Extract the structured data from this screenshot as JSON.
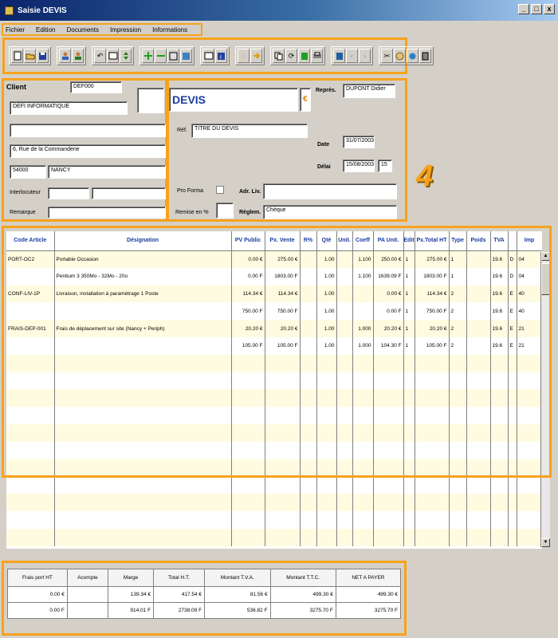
{
  "window": {
    "title": "Saisie DEVIS",
    "controls": [
      "_",
      "□",
      "x"
    ]
  },
  "menu": [
    "Fichier",
    "Edition",
    "Documents",
    "Impression",
    "Informations"
  ],
  "toolbar": {
    "groups": [
      [
        "new-doc-icon",
        "open-folder-icon",
        "save-icon"
      ],
      [
        "user-import-icon",
        "user-export-icon"
      ],
      [
        "undo-icon",
        "edit-icon",
        "sort-icon"
      ],
      [
        "add-line-icon",
        "remove-line-icon",
        "insert-icon",
        "list-icon"
      ],
      [
        "preview-icon",
        "info-icon"
      ],
      [
        "disabled-icon",
        "arrow-icon"
      ],
      [
        "copy-icon",
        "convert-icon",
        "calc-icon",
        "print-icon"
      ],
      [
        "book-icon",
        "nav-prev-icon",
        "nav-next-icon"
      ],
      [
        "cut-icon",
        "palette-icon",
        "settings-icon",
        "exit-icon"
      ]
    ]
  },
  "client": {
    "label": "Client",
    "code": "DEF000",
    "name": "DEFI INFORMATIQUE",
    "address1": "",
    "address2": "6, Rue de la Commanderie",
    "postcode": "54000",
    "city": "NANCY",
    "interlocutor_label": "Interlocuteur",
    "interlocutor_value": "",
    "remark_label": "Remarque",
    "remark_value": ""
  },
  "document": {
    "type": "DEVIS",
    "currency_symbol": "€",
    "reference_label": "Réf.",
    "reference": "TITRE DU DEVIS",
    "rep_label": "Représ.",
    "rep": "DUPONT Didier",
    "date_label": "Date",
    "date": "31/07/2003",
    "delay_label": "Délai",
    "delay_date": "15/08/2003",
    "delay_days": "15",
    "proforma_label": "Pro Forma",
    "delivery_label": "Adr. Liv.",
    "delivery_value": "",
    "discount_label": "Remise en %",
    "discount_value": "",
    "payment_label": "Réglem.",
    "payment_value": "Chèque"
  },
  "annotation_number": "4",
  "grid": {
    "columns": [
      "Code Article",
      "Désignation",
      "PV Public",
      "Px. Vente",
      "R%",
      "Qté",
      "Unit.",
      "Coeff",
      "PA Unit.",
      "Edit",
      "Px.Total HT",
      "Type",
      "Poids",
      "TVA",
      "",
      "Imp"
    ],
    "rows": [
      [
        "PORT-OC2",
        "Portable Occasion",
        "0.00 €",
        "275.00 €",
        "",
        "1.00",
        "",
        "1.100",
        "250.00 €",
        "1",
        "275.00 €",
        "1",
        "",
        "19.6",
        "D",
        "04"
      ],
      [
        "",
        "Pentium 3 350Mo - 32Mo - 20o",
        "0.00 F",
        "1803.00 F",
        "",
        "1.00",
        "",
        "1.100",
        "1639.09 F",
        "1",
        "1803.00 F",
        "1",
        "",
        "19.6",
        "D",
        "04"
      ],
      [
        "CONF-LIV-1P",
        "Livraison, installation à paramétrage 1 Poste",
        "114.34 €",
        "114.34 €",
        "",
        "1.00",
        "",
        "",
        "0.00 €",
        "1",
        "114.34 €",
        "2",
        "",
        "19.6",
        "E",
        "40"
      ],
      [
        "",
        "",
        "750.00 F",
        "750.00 F",
        "",
        "1.00",
        "",
        "",
        "0.00 F",
        "1",
        "750.00 F",
        "2",
        "",
        "19.6",
        "E",
        "40"
      ],
      [
        "FRAIS-DEP-001",
        "Frais de déplacement sur site (Nancy + Periph)",
        "20.20 €",
        "20.20 €",
        "",
        "1.00",
        "",
        "1.000",
        "20.20 €",
        "1",
        "20.20 €",
        "2",
        "",
        "19.6",
        "E",
        "21"
      ],
      [
        "",
        "",
        "105.00 F",
        "105.00 F",
        "",
        "1.00",
        "",
        "1.000",
        "104.30 F",
        "1",
        "105.00 F",
        "2",
        "",
        "19.6",
        "E",
        "21"
      ],
      [
        "",
        "",
        "",
        "",
        "",
        "",
        "",
        "",
        "",
        "",
        "",
        "",
        "",
        "",
        "",
        ""
      ],
      [
        "",
        "",
        "",
        "",
        "",
        "",
        "",
        "",
        "",
        "",
        "",
        "",
        "",
        "",
        "",
        ""
      ],
      [
        "",
        "",
        "",
        "",
        "",
        "",
        "",
        "",
        "",
        "",
        "",
        "",
        "",
        "",
        "",
        ""
      ],
      [
        "",
        "",
        "",
        "",
        "",
        "",
        "",
        "",
        "",
        "",
        "",
        "",
        "",
        "",
        "",
        ""
      ],
      [
        "",
        "",
        "",
        "",
        "",
        "",
        "",
        "",
        "",
        "",
        "",
        "",
        "",
        "",
        "",
        ""
      ],
      [
        "",
        "",
        "",
        "",
        "",
        "",
        "",
        "",
        "",
        "",
        "",
        "",
        "",
        "",
        "",
        ""
      ],
      [
        "",
        "",
        "",
        "",
        "",
        "",
        "",
        "",
        "",
        "",
        "",
        "",
        "",
        "",
        "",
        ""
      ],
      [
        "",
        "",
        "",
        "",
        "",
        "",
        "",
        "",
        "",
        "",
        "",
        "",
        "",
        "",
        "",
        ""
      ],
      [
        "",
        "",
        "",
        "",
        "",
        "",
        "",
        "",
        "",
        "",
        "",
        "",
        "",
        "",
        "",
        ""
      ],
      [
        "",
        "",
        "",
        "",
        "",
        "",
        "",
        "",
        "",
        "",
        "",
        "",
        "",
        "",
        "",
        ""
      ],
      [
        "",
        "",
        "",
        "",
        "",
        "",
        "",
        "",
        "",
        "",
        "",
        "",
        "",
        "",
        "",
        ""
      ]
    ]
  },
  "totals": {
    "headers": [
      "Frais port HT",
      "Acompte",
      "Marge",
      "Total H.T.",
      "Montant T.V.A.",
      "Montant T.T.C.",
      "NET A PAYER"
    ],
    "rows": [
      [
        "0.00 €",
        "",
        "139.34 €",
        "417.54 €",
        "81.56 €",
        "499.30 €",
        "499.30 €"
      ],
      [
        "0.00 F",
        "",
        "914.01 F",
        "2738.09 F",
        "536.82 F",
        "3275.70 F",
        "3275.70 F"
      ]
    ]
  }
}
